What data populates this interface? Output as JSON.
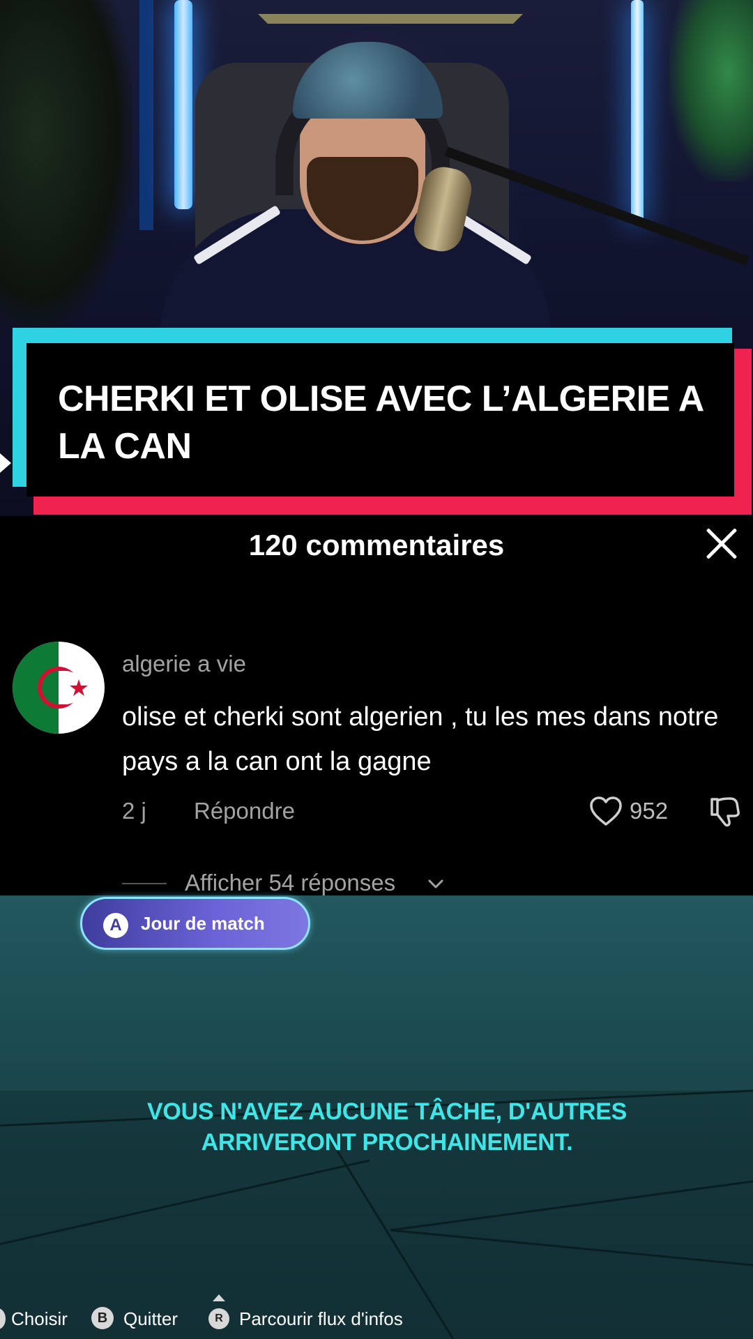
{
  "video": {
    "title_banner": "CHERKI ET OLISE AVEC L’ALGERIE A LA CAN"
  },
  "comments": {
    "count_label": "120 commentaires",
    "close_icon": "close-icon",
    "items": [
      {
        "username": "algerie a vie",
        "avatar": "algeria-flag-avatar",
        "text": "olise et cherki sont algerien , tu les mes dans notre pays a la can ont la gagne",
        "date": "2 j",
        "reply_label": "Répondre",
        "likes": "952",
        "replies_label": "Afficher 54 réponses"
      }
    ]
  },
  "game": {
    "match_button": {
      "key": "A",
      "label": "Jour de match"
    },
    "notice": "VOUS N'AVEZ AUCUNE TÂCHE, D'AUTRES ARRIVERONT PROCHAINEMENT.",
    "footer": {
      "choose_label": "Choisir",
      "quit_key": "B",
      "quit_label": "Quitter",
      "browse_key": "R",
      "browse_label": "Parcourir flux d'infos"
    }
  },
  "colors": {
    "banner_cyan": "#2fd2e3",
    "banner_red": "#f0224f",
    "notice_text": "#3fe6e8",
    "secondary_text": "#a3a3a3"
  }
}
